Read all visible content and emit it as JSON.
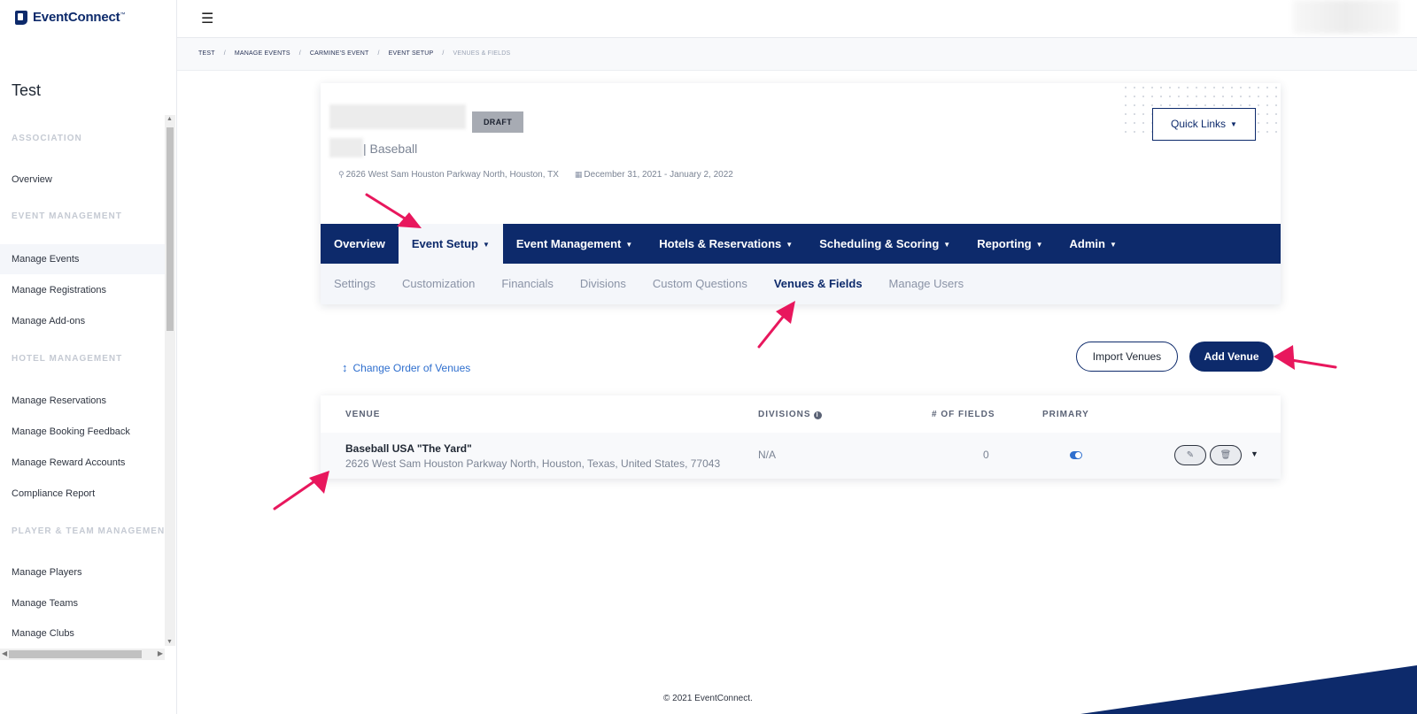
{
  "brand": {
    "name": "EventConnect",
    "mark": "™"
  },
  "sidebar": {
    "org_name": "Test",
    "sections": [
      {
        "title": "Association",
        "items": [
          "Overview"
        ]
      },
      {
        "title": "Event Management",
        "items": [
          "Manage Events",
          "Manage Registrations",
          "Manage Add-ons"
        ]
      },
      {
        "title": "Hotel Management",
        "items": [
          "Manage Reservations",
          "Manage Booking Feedback",
          "Manage Reward Accounts",
          "Compliance Report"
        ]
      },
      {
        "title": "Player & Team Management",
        "items": [
          "Manage Players",
          "Manage Teams",
          "Manage Clubs"
        ]
      }
    ],
    "active_item": "Manage Events"
  },
  "breadcrumb": [
    "Test",
    "Manage Events",
    "Carmine's Event",
    "Event Setup",
    "Venues & Fields"
  ],
  "event": {
    "status": "DRAFT",
    "sport": "| Baseball",
    "location": "2626 West Sam Houston Parkway North, Houston, TX",
    "dates": "December 31, 2021 - January 2, 2022",
    "quick_links": "Quick Links"
  },
  "main_nav": {
    "tabs": [
      "Overview",
      "Event Setup",
      "Event Management",
      "Hotels & Reservations",
      "Scheduling & Scoring",
      "Reporting",
      "Admin"
    ],
    "active": "Event Setup"
  },
  "sub_nav": {
    "tabs": [
      "Settings",
      "Customization",
      "Financials",
      "Divisions",
      "Custom Questions",
      "Venues & Fields",
      "Manage Users"
    ],
    "active": "Venues & Fields"
  },
  "venues": {
    "change_order": "Change Order of Venues",
    "import_label": "Import Venues",
    "add_label": "Add Venue",
    "headers": {
      "venue": "Venue",
      "divisions": "Divisions",
      "fields": "# of Fields",
      "primary": "Primary"
    },
    "rows": [
      {
        "name": "Baseball USA \"The Yard\"",
        "address": "2626 West Sam Houston Parkway North, Houston, Texas, United States, 77043",
        "divisions": "N/A",
        "fields": "0",
        "primary": true
      }
    ]
  },
  "footer": {
    "copyright": "© 2021 EventConnect."
  },
  "colors": {
    "brand_navy": "#0d2a6b",
    "link_blue": "#2f6fce",
    "annotation_pink": "#e8175d"
  }
}
